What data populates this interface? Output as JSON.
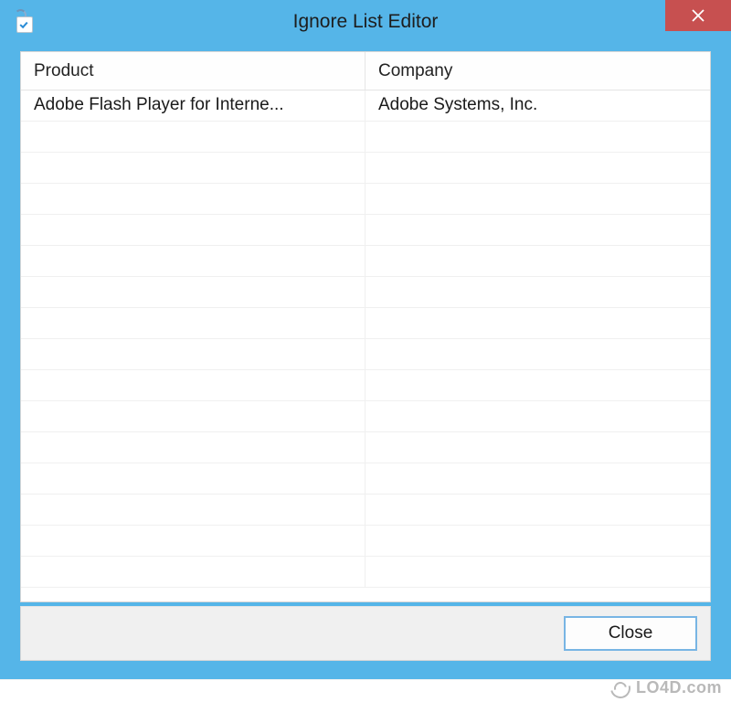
{
  "window": {
    "title": "Ignore List Editor"
  },
  "table": {
    "headers": {
      "product": "Product",
      "company": "Company"
    },
    "rows": [
      {
        "product": "Adobe Flash Player for Interne...",
        "company": "Adobe Systems, Inc."
      }
    ],
    "empty_row_count": 15
  },
  "footer": {
    "close_label": "Close"
  },
  "watermark": {
    "text": "LO4D.com"
  }
}
